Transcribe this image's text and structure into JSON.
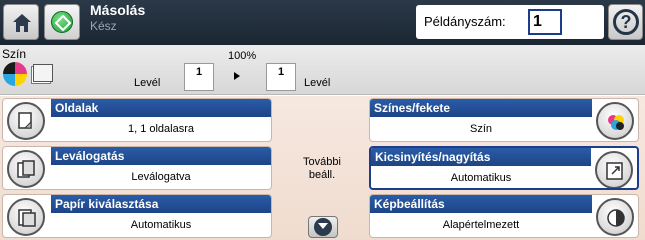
{
  "header": {
    "title": "Másolás",
    "status": "Kész",
    "copies_label": "Példányszám:",
    "copies_value": "1"
  },
  "preview": {
    "color_label": "Szín",
    "scale_percent": "100%",
    "source_size": "Levél",
    "source_pages": "1",
    "target_size": "Levél",
    "target_pages": "1"
  },
  "options": {
    "left": [
      {
        "label": "Oldalak",
        "value": "1, 1 oldalasra",
        "icon": "sides-icon"
      },
      {
        "label": "Leválogatás",
        "value": "Leválogatva",
        "icon": "collate-icon"
      },
      {
        "label": "Papír kiválasztása",
        "value": "Automatikus",
        "icon": "paper-select-icon"
      }
    ],
    "right": [
      {
        "label": "Színes/fekete",
        "value": "Szín",
        "icon": "color-black-icon"
      },
      {
        "label": "Kicsinyítés/nagyítás",
        "value": "Automatikus",
        "icon": "reduce-enlarge-icon"
      },
      {
        "label": "Képbeállítás",
        "value": "Alapértelmezett",
        "icon": "image-adjust-icon"
      }
    ],
    "more_settings": "További beáll."
  },
  "colors": {
    "header_bg": "#1b2632",
    "option_header": "#2a5ca8",
    "options_bg": "#f6e8e0",
    "start_green": "#1d9a35"
  }
}
